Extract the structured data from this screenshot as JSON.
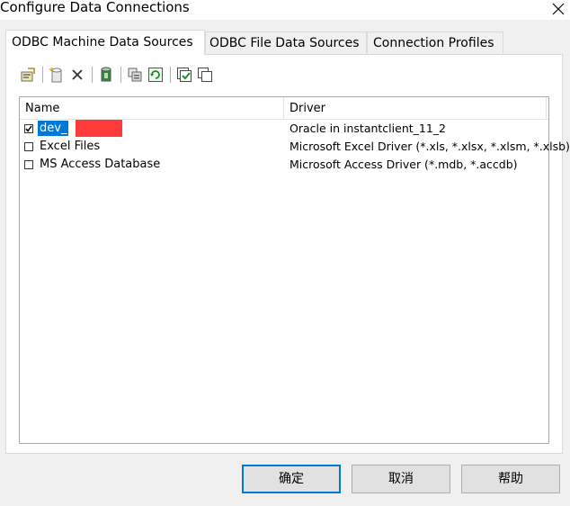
{
  "window": {
    "title": "Configure Data Connections"
  },
  "tabs": [
    {
      "label": "ODBC Machine Data Sources",
      "active": true
    },
    {
      "label": "ODBC File Data Sources",
      "active": false
    },
    {
      "label": "Connection Profiles",
      "active": false
    }
  ],
  "toolbar": {
    "buttons": [
      "edit-properties-icon",
      "new-datasource-icon",
      "delete-icon",
      "database-icon",
      "configure-icon",
      "refresh-icon",
      "check-all-icon",
      "copy-icon"
    ]
  },
  "list": {
    "columns": [
      "Name",
      "Driver"
    ],
    "rows": [
      {
        "name": "dev_",
        "driver": "Oracle in instantclient_11_2",
        "checked": true,
        "selected": true
      },
      {
        "name": "Excel Files",
        "driver": "Microsoft Excel Driver (*.xls, *.xlsx, *.xlsm, *.xlsb)",
        "checked": false,
        "selected": false
      },
      {
        "name": "MS Access Database",
        "driver": "Microsoft Access Driver (*.mdb, *.accdb)",
        "checked": false,
        "selected": false
      }
    ]
  },
  "buttons": {
    "ok": "确定",
    "cancel": "取消",
    "help": "帮助"
  },
  "colors": {
    "accent": "#0078d7",
    "redaction": "#ff3b3b"
  }
}
